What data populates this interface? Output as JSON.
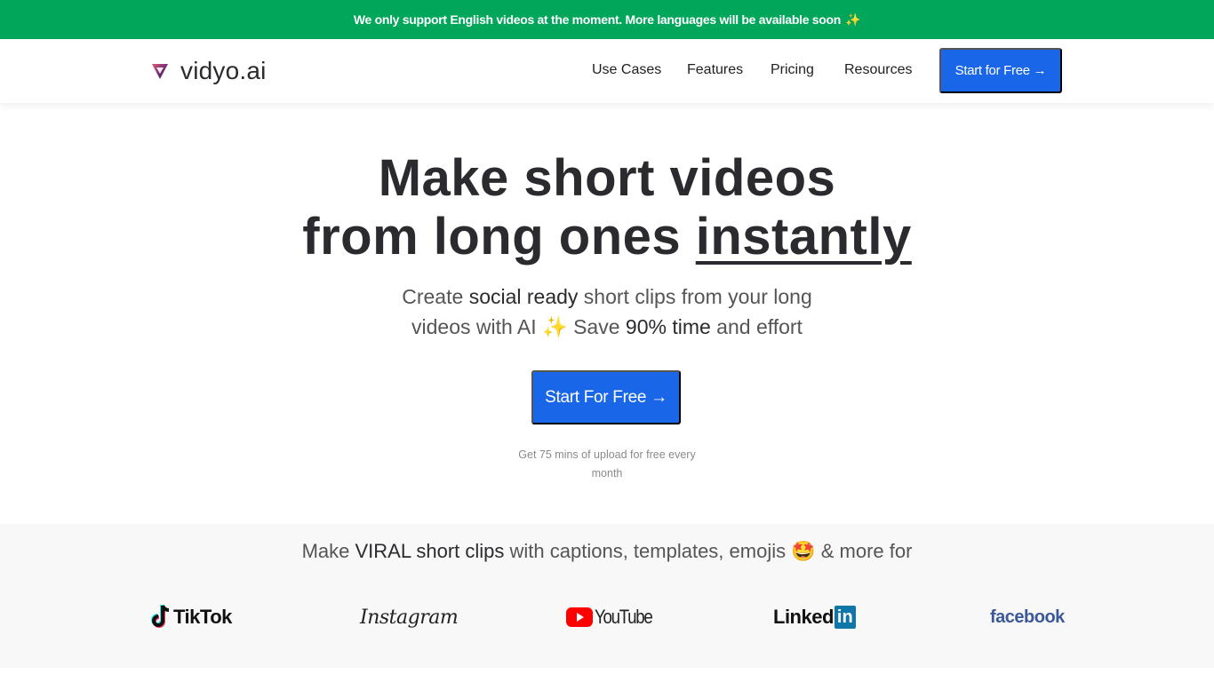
{
  "announcement": {
    "text": "We only support English videos at the moment. More languages will be available soon",
    "emoji": "✨"
  },
  "navbar": {
    "logo_text": "vidyo.ai",
    "links": [
      {
        "label": "Use Cases"
      },
      {
        "label": "Features"
      },
      {
        "label": "Pricing"
      },
      {
        "label": "Resources"
      }
    ],
    "cta_label": "Start for Free →"
  },
  "hero": {
    "title_line1": "Make short videos",
    "title_line2_prefix": "from long ones ",
    "title_line2_emphasis": "instantly",
    "subtitle": {
      "part1": "Create ",
      "part2_em": "social ready",
      "part3": " short clips from your long",
      "part4": "videos with AI ",
      "sparkle": "✨",
      "part5": " Save ",
      "part6_em": "90% time",
      "part7": " and effort"
    },
    "cta_label": "Start For Free →",
    "note": "Get 75 mins of upload for free every month"
  },
  "platforms": {
    "title": {
      "part1": "Make ",
      "part2_em": "VIRAL short clips",
      "part3": " with captions, templates, emojis ",
      "emoji": "🤩",
      "part4": " & more for"
    },
    "brands": [
      {
        "name": "TikTok",
        "icon": "tiktok-note-icon"
      },
      {
        "name": "Instagram"
      },
      {
        "name": "YouTube",
        "icon": "youtube-play-icon"
      },
      {
        "name": "Linked",
        "badge": "in"
      },
      {
        "name": "facebook"
      }
    ]
  },
  "colors": {
    "announcement_bg": "#00a65a",
    "primary_button": "#1a66e8",
    "platforms_bg": "#f8f8f8"
  }
}
